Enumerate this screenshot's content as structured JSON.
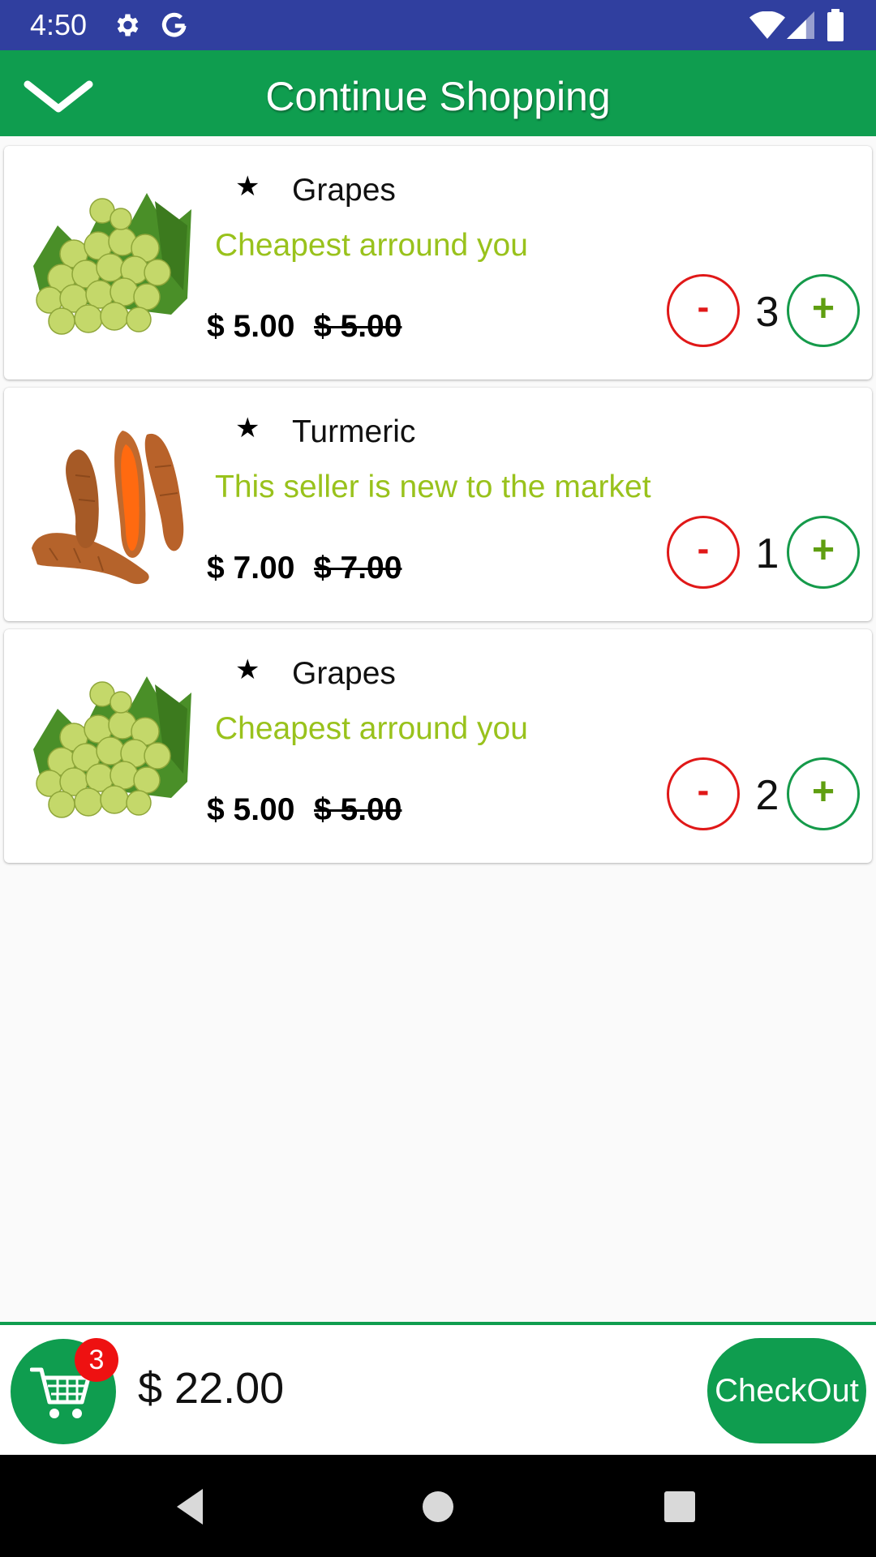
{
  "status_bar": {
    "time": "4:50",
    "icons": [
      "gear-icon",
      "google-g-icon",
      "wifi-icon",
      "signal-icon",
      "battery-icon"
    ]
  },
  "app_bar": {
    "title": "Continue Shopping",
    "collapse_icon": "chevron-down-icon",
    "background": "#0f9d4f"
  },
  "cart_items": [
    {
      "image": "grapes-image",
      "name": "Grapes",
      "description": "Cheapest arround you",
      "price": "$ 5.00",
      "old_price": "$ 5.00",
      "minus_label": "-",
      "quantity": "3",
      "plus_label": "+"
    },
    {
      "image": "turmeric-image",
      "name": "Turmeric",
      "description": "This seller is new to the market",
      "price": "$ 7.00",
      "old_price": "$ 7.00",
      "minus_label": "-",
      "quantity": "1",
      "plus_label": "+"
    },
    {
      "image": "grapes-image",
      "name": "Grapes",
      "description": "Cheapest arround you",
      "price": "$ 5.00",
      "old_price": "$ 5.00",
      "minus_label": "-",
      "quantity": "2",
      "plus_label": "+"
    }
  ],
  "bottom_bar": {
    "cart_count": "3",
    "total": "$ 22.00",
    "checkout_label": "CheckOut"
  },
  "colors": {
    "primary_green": "#0f9d4f",
    "status_bar": "#303f9f",
    "description_green": "#99c21c",
    "minus_red": "#e01818",
    "badge_red": "#ee1111"
  }
}
